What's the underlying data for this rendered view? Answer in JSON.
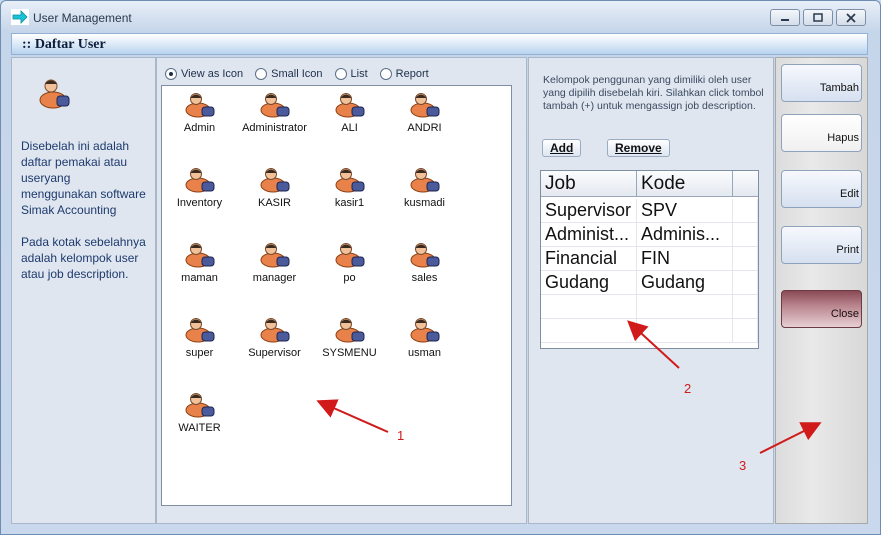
{
  "window": {
    "title": "User Management",
    "controls": [
      "minimize",
      "maximize",
      "close"
    ]
  },
  "header": {
    "title": ":: Daftar User"
  },
  "left_panel": {
    "icon": "users-icon",
    "description": "Disebelah ini adalah daftar pemakai atau useryang menggunakan software Simak Accounting\n\nPada kotak sebelahnya adalah kelompok user atau job description."
  },
  "view_options": [
    {
      "label": "View as Icon",
      "selected": true
    },
    {
      "label": "Small Icon",
      "selected": false
    },
    {
      "label": "List",
      "selected": false
    },
    {
      "label": "Report",
      "selected": false
    }
  ],
  "users": [
    "Admin",
    "Administrator",
    "ALI",
    "ANDRI",
    "Inventory",
    "KASIR",
    "kasir1",
    "kusmadi",
    "maman",
    "manager",
    "po",
    "sales",
    "super",
    "Supervisor",
    "SYSMENU",
    "usman",
    "WAITER"
  ],
  "job_panel": {
    "description": "Kelompok penggunan yang dimiliki oleh user yang dipilih disebelah kiri. Silahkan click tombol tambah (+) untuk mengassign job description.",
    "add_label": "Add",
    "remove_label": "Remove",
    "columns": [
      "Job",
      "Kode"
    ],
    "rows": [
      [
        "Supervisor",
        "SPV"
      ],
      [
        "Administ...",
        "Adminis..."
      ],
      [
        "Financial",
        "FIN"
      ],
      [
        "Gudang",
        "Gudang"
      ]
    ]
  },
  "actions": {
    "tambah": "Tambah",
    "hapus": "Hapus",
    "edit": "Edit",
    "print": "Print",
    "close": "Close"
  },
  "annotations": [
    "1",
    "2",
    "3"
  ],
  "colors": {
    "annotation": "#d11a1a",
    "header_text": "#0d1f3a",
    "description_text": "#1e3a6e",
    "close_button": "#b9848d"
  }
}
